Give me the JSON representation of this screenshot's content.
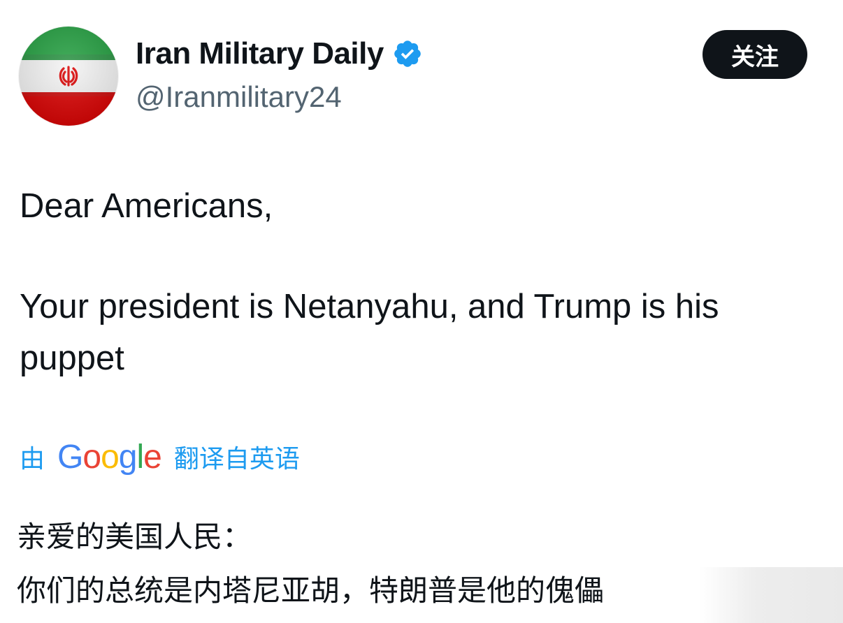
{
  "author": {
    "display_name": "Iran Military Daily",
    "handle": "@Iranmilitary24",
    "avatar_icon": "iran-flag-icon",
    "verified_icon": "verified-badge-icon",
    "verified_color": "#1d9bf0"
  },
  "follow_button": {
    "label": "关注"
  },
  "post": {
    "line_1": "Dear Americans,",
    "line_2": "Your president is Netanyahu, and Trump is his",
    "line_3": "puppet"
  },
  "translation": {
    "prefix": "由",
    "brand": "Google",
    "suffix": "翻译自英语",
    "link_color": "#1d9bf0",
    "zh_line_1": "亲爱的美国人民：",
    "zh_line_2": "你们的总统是内塔尼亚胡，特朗普是他的傀儡"
  },
  "colors": {
    "text": "#0f1419",
    "secondary_text": "#536471",
    "button_bg": "#0f1419"
  }
}
